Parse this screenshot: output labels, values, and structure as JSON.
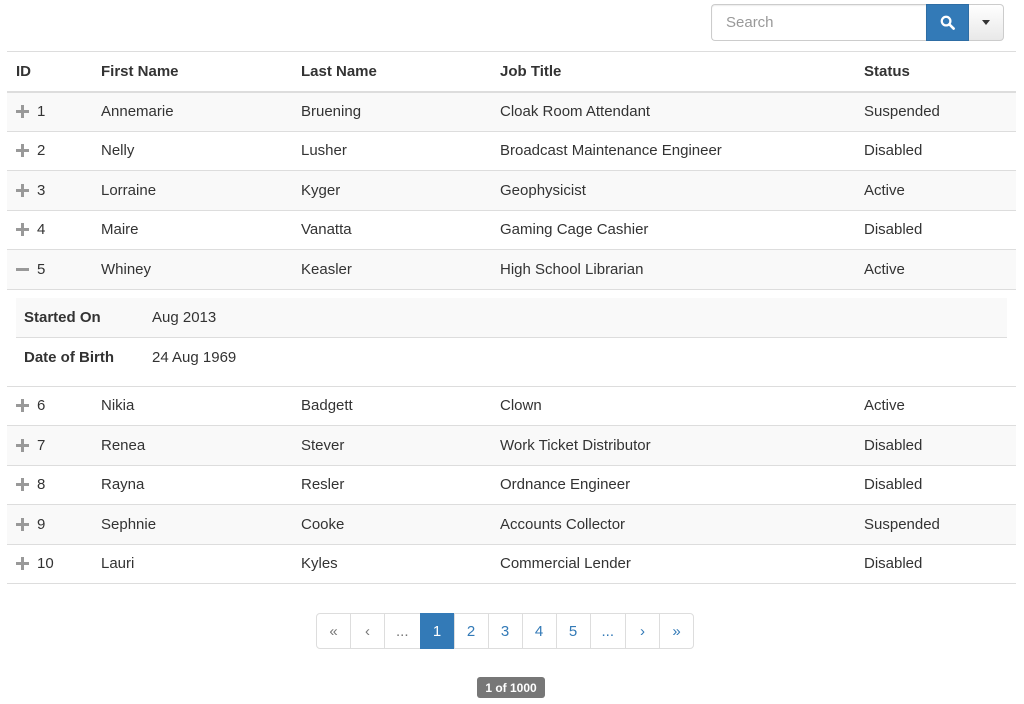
{
  "search": {
    "placeholder": "Search"
  },
  "columns": [
    "ID",
    "First Name",
    "Last Name",
    "Job Title",
    "Status"
  ],
  "rows": [
    {
      "id": "1",
      "first": "Annemarie",
      "last": "Bruening",
      "job": "Cloak Room Attendant",
      "status": "Suspended",
      "expanded": false
    },
    {
      "id": "2",
      "first": "Nelly",
      "last": "Lusher",
      "job": "Broadcast Maintenance Engineer",
      "status": "Disabled",
      "expanded": false
    },
    {
      "id": "3",
      "first": "Lorraine",
      "last": "Kyger",
      "job": "Geophysicist",
      "status": "Active",
      "expanded": false
    },
    {
      "id": "4",
      "first": "Maire",
      "last": "Vanatta",
      "job": "Gaming Cage Cashier",
      "status": "Disabled",
      "expanded": false
    },
    {
      "id": "5",
      "first": "Whiney",
      "last": "Keasler",
      "job": "High School Librarian",
      "status": "Active",
      "expanded": true
    },
    {
      "id": "6",
      "first": "Nikia",
      "last": "Badgett",
      "job": "Clown",
      "status": "Active",
      "expanded": false
    },
    {
      "id": "7",
      "first": "Renea",
      "last": "Stever",
      "job": "Work Ticket Distributor",
      "status": "Disabled",
      "expanded": false
    },
    {
      "id": "8",
      "first": "Rayna",
      "last": "Resler",
      "job": "Ordnance Engineer",
      "status": "Disabled",
      "expanded": false
    },
    {
      "id": "9",
      "first": "Sephnie",
      "last": "Cooke",
      "job": "Accounts Collector",
      "status": "Suspended",
      "expanded": false
    },
    {
      "id": "10",
      "first": "Lauri",
      "last": "Kyles",
      "job": "Commercial Lender",
      "status": "Disabled",
      "expanded": false
    }
  ],
  "detail": {
    "started_label": "Started On",
    "started_value": "Aug 2013",
    "dob_label": "Date of Birth",
    "dob_value": "24 Aug 1969"
  },
  "pagination": {
    "first": "«",
    "prev": "‹",
    "ellipsis_left": "...",
    "pages": [
      "1",
      "2",
      "3",
      "4",
      "5"
    ],
    "active_page": "1",
    "ellipsis_right": "...",
    "next": "›",
    "last": "»"
  },
  "page_count": "1 of 1000",
  "colors": {
    "accent": "#337ab7",
    "stripe": "#f9f9f9",
    "border": "#dddddd",
    "badge": "#777777"
  },
  "icons": {
    "search": "search-icon",
    "dropdown": "caret-down-icon",
    "expand": "plus-icon",
    "collapse": "minus-icon"
  }
}
